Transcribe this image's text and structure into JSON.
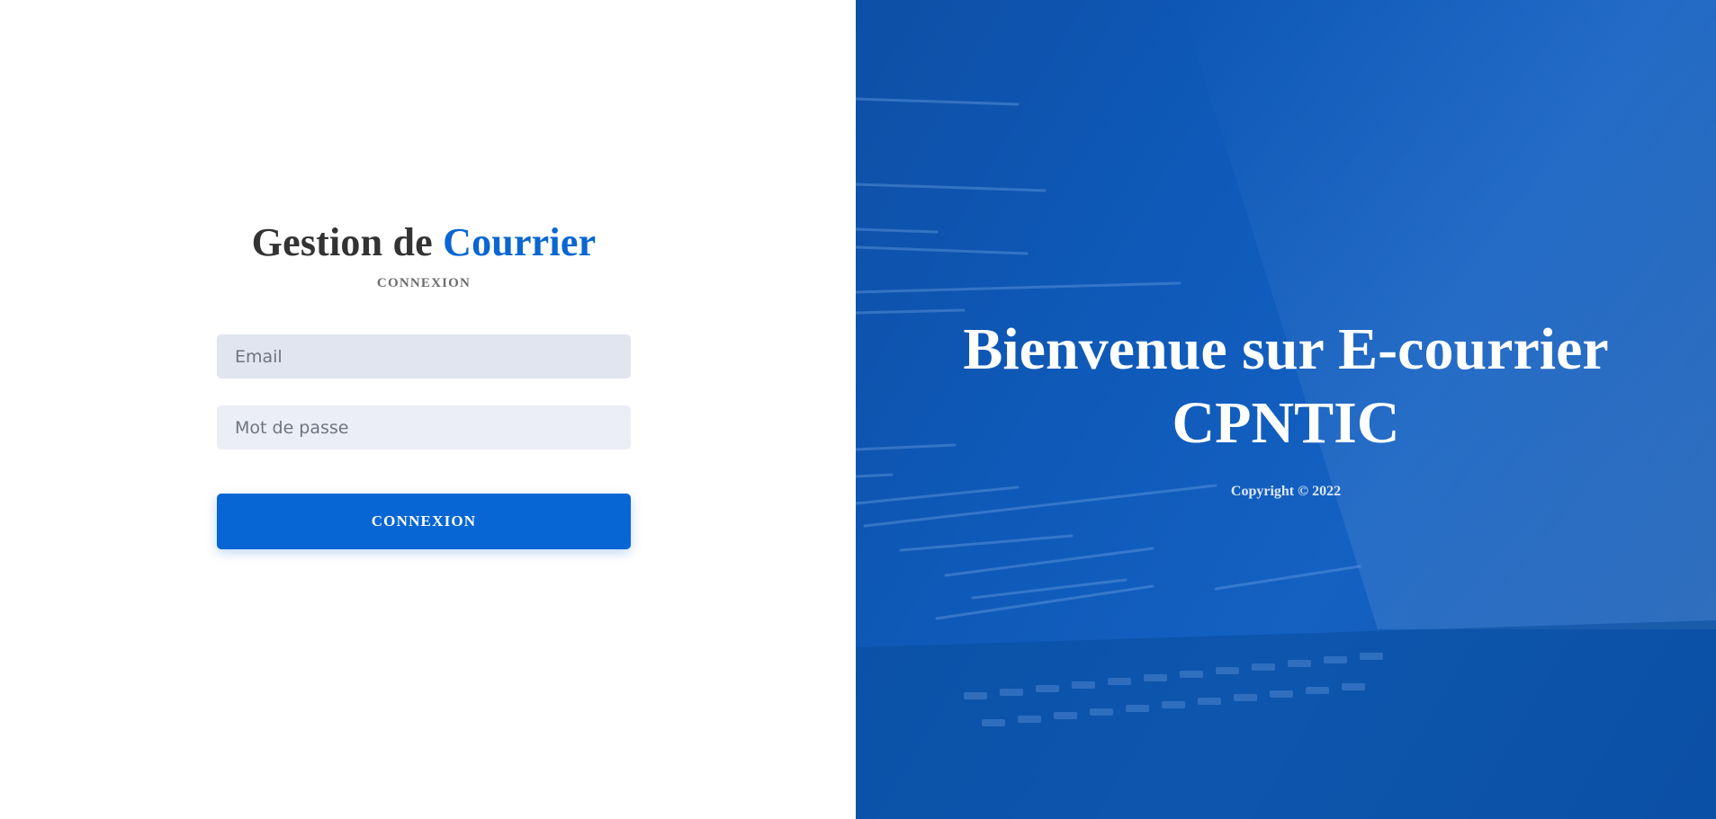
{
  "login": {
    "title_part1": "Gestion de",
    "title_part2": "Courrier",
    "subtitle": "CONNEXION",
    "email_placeholder": "Email",
    "password_placeholder": "Mot de passe",
    "submit_label": "CONNEXION"
  },
  "hero": {
    "welcome_line1": "Bienvenue sur E-courrier",
    "welcome_line2": "CPNTIC",
    "copyright": "Copyright © 2022"
  },
  "colors": {
    "accent": "#0a66d1",
    "button": "#0766d3",
    "hero_background": "#0f5ab9",
    "email_field_bg": "#e0e5f0",
    "password_field_bg": "#ebeef6"
  }
}
